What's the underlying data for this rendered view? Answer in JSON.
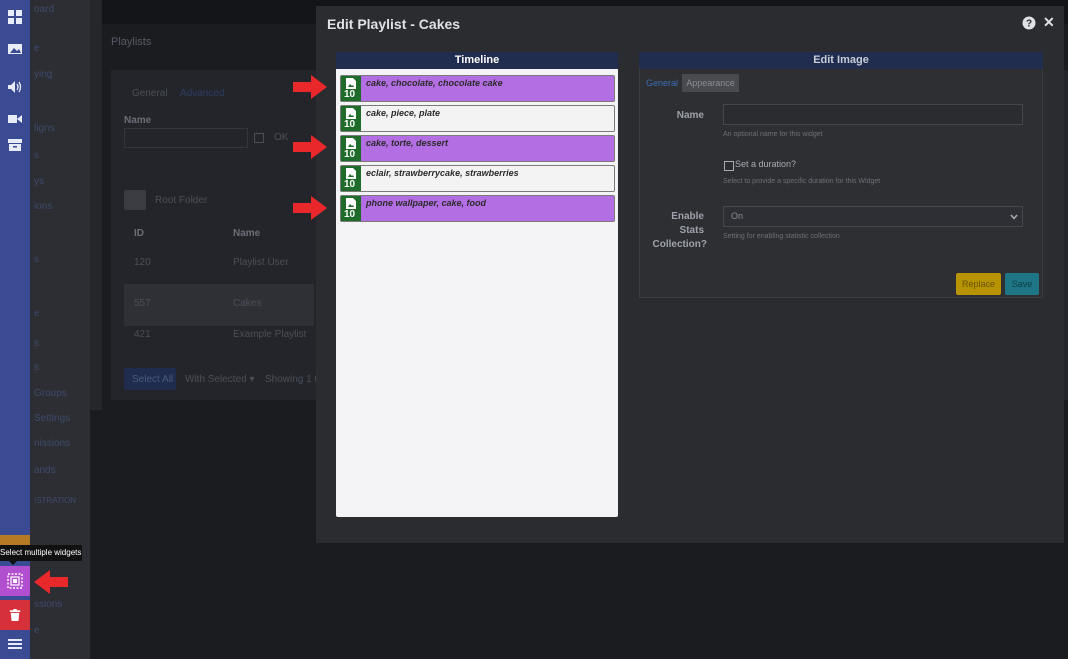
{
  "background": {
    "sidebar_items": [
      "oard",
      "e",
      "ying",
      "ligns",
      "s",
      "ys",
      "ions",
      "s",
      "e",
      "s",
      "s",
      "Groups",
      "Settings",
      "nissions",
      "ands",
      "ISTRATION",
      "ssions",
      "e"
    ],
    "breadcrumb": "Playlists",
    "tabs": [
      "General",
      "Advanced"
    ],
    "name_label": "Name",
    "ok_label": "OK",
    "root_folder": "Root Folder",
    "table_headers": [
      "ID",
      "Name"
    ],
    "rows": [
      {
        "id": "120",
        "name": "Playlist User"
      },
      {
        "id": "557",
        "name": "Cakes"
      },
      {
        "id": "421",
        "name": "Example Playlist"
      }
    ],
    "select_all": "Select All",
    "with_selected": "With Selected ▾",
    "showing": "Showing 1 t"
  },
  "modal": {
    "title": "Edit Playlist - Cakes",
    "timeline_title": "Timeline",
    "widgets": [
      {
        "name": "cake, chocolate, chocolate cake",
        "duration": "10",
        "selected": true
      },
      {
        "name": "cake, piece, plate",
        "duration": "10",
        "selected": false
      },
      {
        "name": "cake, torte, dessert",
        "duration": "10",
        "selected": true
      },
      {
        "name": "eclair, strawberrycake, strawberries",
        "duration": "10",
        "selected": false
      },
      {
        "name": "phone wallpaper, cake, food",
        "duration": "10",
        "selected": true
      }
    ]
  },
  "edit_image": {
    "title": "Edit Image",
    "tabs": [
      "General",
      "Appearance"
    ],
    "name_label": "Name",
    "name_help": "An optional name for this widget",
    "name_value": "",
    "duration_label": "Set a duration?",
    "duration_help": "Select to provide a specific duration for this Widget",
    "stats_label_1": "Enable",
    "stats_label_2": "Stats",
    "stats_label_3": "Collection?",
    "stats_value": "On",
    "stats_help": "Setting for enabling statistic collection",
    "replace": "Replace",
    "save": "Save"
  },
  "tooltip": "Select multiple widgets",
  "colors": {
    "selected_widget": "#b36ee3",
    "widget_badge": "#1f6b2a",
    "timeline_header": "#202d4e",
    "arrow": "#e8282b",
    "rail": "#3a4a93",
    "replace_button": "#b89300",
    "save_button": "#1e7585"
  },
  "icons": [
    "dashboard-icon",
    "image-icon",
    "audio-icon",
    "video-icon",
    "archive-icon",
    "question-icon",
    "close-icon",
    "file-image-icon",
    "chevron-down-icon",
    "multi-select-icon",
    "trash-icon",
    "menu-icon",
    "arrow-right-icon",
    "arrow-left-icon",
    "folder-icon"
  ]
}
